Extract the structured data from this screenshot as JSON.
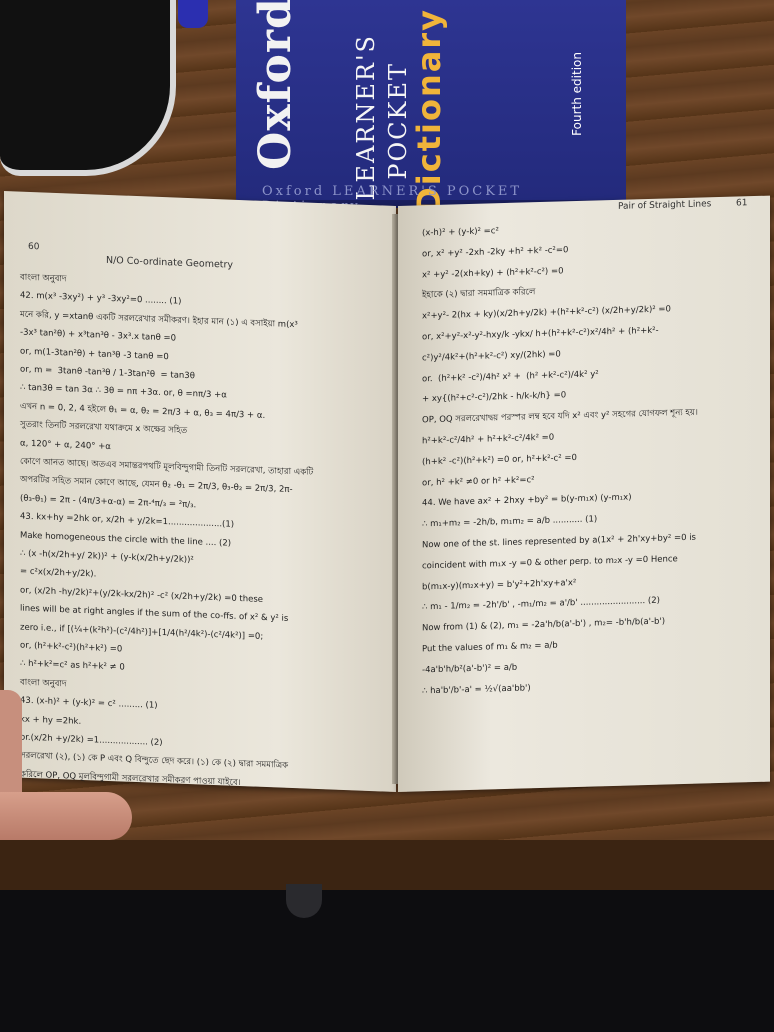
{
  "dictionary": {
    "brand": "Oxford",
    "title_line1": "LEARNER'S",
    "title_line2": "POCKET",
    "title_line3": "Dictionary",
    "edition": "Fourth edition",
    "spine": "Oxford LEARNER'S POCKET Dictionary"
  },
  "left_page": {
    "page_number": "60",
    "running_head": "N/O Co-ordinate Geometry",
    "lines": [
      "বাংলা অনুবাদ",
      "42. m(x³ -3xy²) + y³ -3xy²=0 ........ (1)",
      "মনে করি, y =xtanθ একটি সরলরেখার সমীকরণ। ইহার মান (১) এ বসাইয়া m(x³",
      "-3x³ tan²θ) + x³tan³θ - 3x³.x tanθ =0",
      "or, m(1-3tan²θ) + tan³θ -3 tanθ =0",
      "or, m =  3tanθ -tan³θ / 1-3tan²θ  = tan3θ",
      "∴ tan3θ = tan 3α ∴ 3θ = nπ +3α. or, θ =nπ/3 +α",
      "এখন n = 0, 2, 4 হইলে θ₁ = α, θ₂ = 2π/3 + α, θ₃ = 4π/3 + α.",
      "সুতরাং তিনটি সরলরেখা যথাক্রমে x অক্ষের সহিত",
      "α, 120° + α, 240° +α",
      "কোণে আনত আছে। অতএব সমান্তরপথটি মূলবিন্দুগামী তিনটি সরলরেখা, তাহারা একটি",
      "অপরটির সহিত সমান কোণে আছে, যেমন θ₂ -θ₁ = 2π/3, θ₃-θ₂ = 2π/3, 2π-",
      "(θ₃-θ₁) = 2π - (4π/3+α-α) = 2π-⁴π/₃ = ²π/₃.",
      "43. kx+hy =2hk or, x/2h + y/2k=1....................(1)",
      "Make homogeneous the circle with the line .... (2)",
      "∴ (x -h(x/2h+y/ 2k))² + (y-k(x/2h+y/2k))²",
      "= c²x(x/2h+y/2k).",
      "or, (x/2h -hy/2k)²+(y/2k-kx/2h)² -c² (x/2h+y/2k) =0 these",
      "lines will be at right angles if the sum of the co-ffs. of x² & y² is",
      "zero i.e., if [(¼+(k²h²)-(c²/4h²)]+[1/4(h²/4k²)-(c²/4k²)] =0;",
      "or, (h²+k²-c²)(h²+k²) =0",
      "∴ h²+k²=c² as h²+k² ≠ 0",
      "বাংলা অনুবাদ",
      "43. (x-h)² + (y-k)² = c² ......... (1)",
      "kx + hy =2hk.",
      "or.(x/2h +y/2k) =1.................. (2)",
      "সরলরেখা (২), (১) কে P এবং Q বিন্দুতে ছেদ করে। (১) কে (২) দ্বারা সমমাত্রিক",
      "করিলে OP, OQ মূলবিন্দুগামী সরলরেখার সমীকরণ পাওয়া যাইবে।"
    ]
  },
  "right_page": {
    "page_number": "61",
    "running_head": "Pair of Straight Lines",
    "lines": [
      "(x-h)² + (y-k)² =c²",
      "or, x² +y² -2xh -2ky +h² +k² -c²=0",
      "x² +y² -2(xh+ky) + (h²+k²-c²) =0",
      "ইহাকে (২) দ্বারা সমমাত্রিক করিলে",
      "x²+y²- 2(hx + ky)(x/2h+y/2k) +(h²+k²-c²) (x/2h+y/2k)² =0",
      "or, x²+y²-x²-y²-hxy/k -ykx/ h+(h²+k²-c²)x²/4h² + (h²+k²-",
      "c²)y²/4k²+(h²+k²-c²) xy/(2hk) =0",
      "or.  (h²+k² -c²)/4h² x² +  (h² +k²-c²)/4k² y²",
      "+ xy{(h²+c²-c²)/2hk - h/k-k/h} =0",
      "OP, OQ সরলরেখাদ্বয় পরস্পর লম্ব হবে যদি x² এবং y² সহগের যোগফল শূন্য হয়।",
      "h²+k²-c²/4h² + h²+k²-c²/4k² =0",
      "(h+k² -c²)(h²+k²) =0 or, h²+k²-c² =0",
      "or, h² +k² ≠0 or h² +k²=c²",
      "44. We have ax² + 2hxy +by² = b(y-m₁x) (y-m₁x)",
      "∴ m₁+m₂ = -2h/b, m₁m₂ = a/b ........... (1)",
      "Now one of the st. lines represented by a(1x² + 2h'xy+by² =0 is",
      "coincident with m₁x -y =0 & other perp. to m₂x -y =0 Hence",
      "b(m₁x-y)(m₂x+y) = b'y²+2h'xy+a'x²",
      "∴ m₁ - 1/m₂ = -2h'/b' , -m₁/m₂ = a'/b' ........................ (2)",
      "Now from (1) & (2), m₁ = -2a'h/b(a'-b') , m₂= -b'h/b(a'-b')",
      "Put the values of m₁ & m₂ = a/b",
      "-4a'b'h/b²(a'-b')² = a/b",
      "∴ ha'b'/b'-a' = ½√(aa'bb')"
    ]
  }
}
